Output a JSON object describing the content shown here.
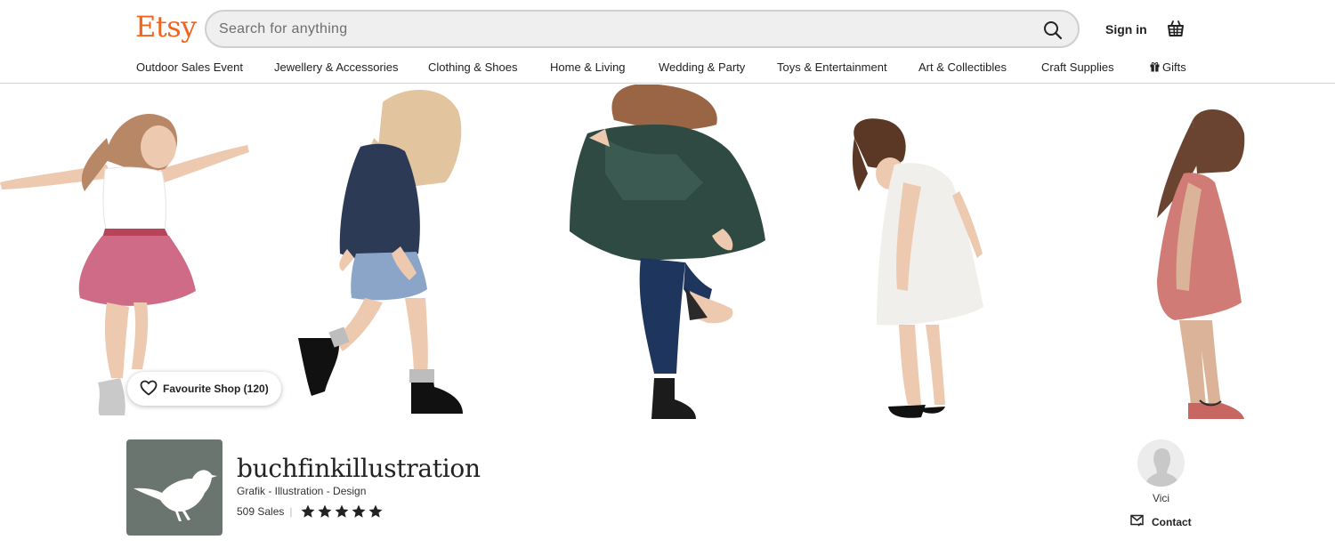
{
  "header": {
    "logo": "Etsy",
    "search_placeholder": "Search for anything",
    "signin_label": "Sign in"
  },
  "nav": {
    "items": [
      "Outdoor Sales Event",
      "Jewellery & Accessories",
      "Clothing & Shoes",
      "Home & Living",
      "Wedding & Party",
      "Toys & Entertainment",
      "Art & Collectibles",
      "Craft Supplies",
      "Gifts"
    ]
  },
  "banner": {
    "favourite_label": "Favourite Shop (120)"
  },
  "shop": {
    "name": "buchfinkillustration",
    "tagline": "Grafik - Illustration - Design",
    "sales": "509 Sales",
    "rating": 5,
    "rating_max": 5
  },
  "owner": {
    "name": "Vici",
    "contact_label": "Contact"
  },
  "colors": {
    "brand": "#F1641E",
    "text": "#222222",
    "shop_logo_bg": "#6b7570"
  }
}
